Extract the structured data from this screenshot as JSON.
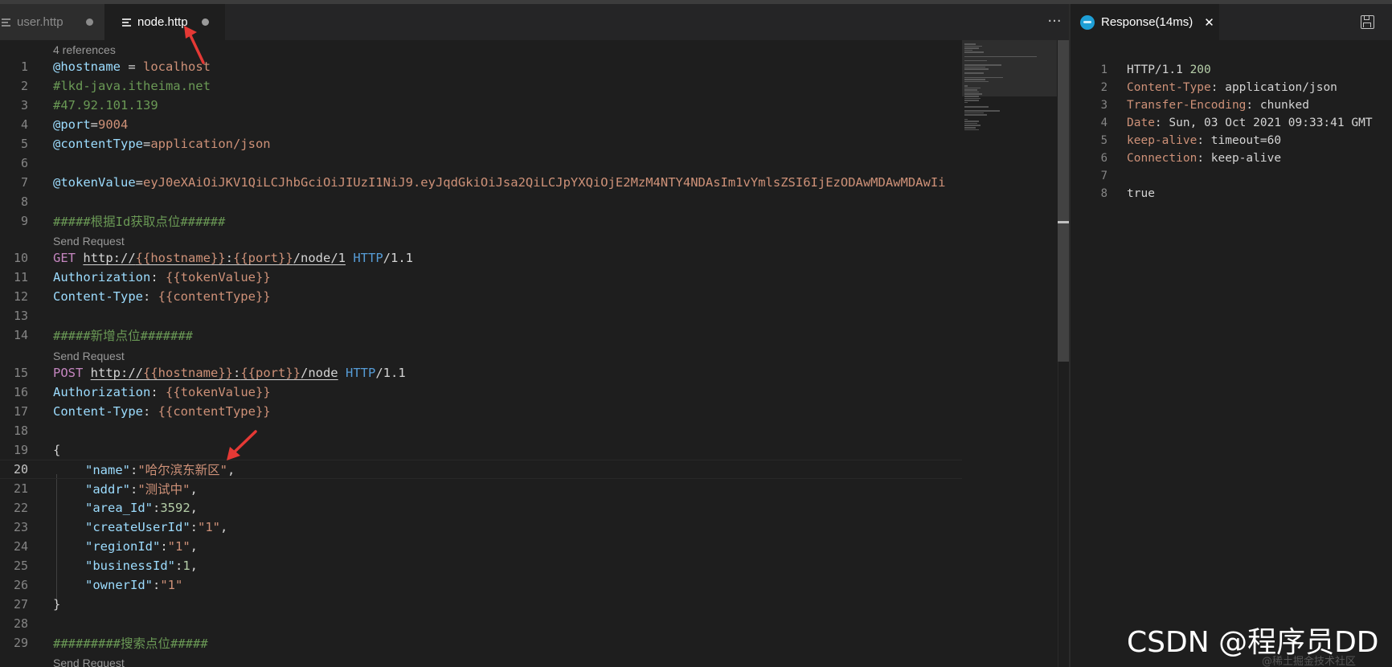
{
  "tabs": {
    "user": "user.http",
    "node": "node.http",
    "more": "···"
  },
  "response_tab": {
    "label": "Response(14ms)",
    "close": "✕"
  },
  "codelens": {
    "references": "4 references",
    "send_request": "Send Request"
  },
  "editor": {
    "line_numbers": [
      "1",
      "2",
      "3",
      "4",
      "5",
      "6",
      "7",
      "8",
      "9",
      "10",
      "11",
      "12",
      "13",
      "14",
      "15",
      "16",
      "17",
      "18",
      "19",
      "20",
      "21",
      "22",
      "23",
      "24",
      "25",
      "26",
      "27",
      "28",
      "29"
    ],
    "l1": {
      "var": "@hostname",
      "op": " = ",
      "val": "localhost"
    },
    "l2": "#lkd-java.itheima.net",
    "l3": "#47.92.101.139",
    "l4": {
      "var": "@port",
      "op": "=",
      "val": "9004"
    },
    "l5": {
      "var": "@contentType",
      "op": "=",
      "val": "application/json"
    },
    "l7": {
      "var": "@tokenValue",
      "op": "=",
      "val": "eyJ0eXAiOiJKV1QiLCJhbGciOiJIUzI1NiJ9.eyJqdGkiOiJsa2QiLCJpYXQiOjE2MzM4NTY4NDAsIm1vYmlsZSI6IjEzODAwMDAwMDAwIi"
    },
    "l9": "#####根据Id获取点位######",
    "l10": {
      "method": "GET",
      "url_a": "http://",
      "url_var1": "{{hostname}}",
      "url_b": ":",
      "url_var2": "{{port}}",
      "url_c": "/node/1",
      "ver_a": "HTTP",
      "ver_b": "/1.1"
    },
    "l11": {
      "key": "Authorization",
      "sep": ": ",
      "val": "{{tokenValue}}"
    },
    "l12": {
      "key": "Content-Type",
      "sep": ": ",
      "val": "{{contentType}}"
    },
    "l14": "#####新增点位#######",
    "l15": {
      "method": "POST",
      "url_a": "http://",
      "url_var1": "{{hostname}}",
      "url_b": ":",
      "url_var2": "{{port}}",
      "url_c": "/node",
      "ver_a": "HTTP",
      "ver_b": "/1.1"
    },
    "l16": {
      "key": "Authorization",
      "sep": ": ",
      "val": "{{tokenValue}}"
    },
    "l17": {
      "key": "Content-Type",
      "sep": ": ",
      "val": "{{contentType}}"
    },
    "l19": "{",
    "l20": {
      "key": "\"name\"",
      "sep": ":",
      "val": "\"哈尔滨东新区\"",
      "end": ","
    },
    "l21": {
      "key": "\"addr\"",
      "sep": ":",
      "val": "\"测试中\"",
      "end": ","
    },
    "l22": {
      "key": "\"area_Id\"",
      "sep": ":",
      "val": "3592",
      "end": ","
    },
    "l23": {
      "key": "\"createUserId\"",
      "sep": ":",
      "val": "\"1\"",
      "end": ","
    },
    "l24": {
      "key": "\"regionId\"",
      "sep": ":",
      "val": "\"1\"",
      "end": ","
    },
    "l25": {
      "key": "\"businessId\"",
      "sep": ":",
      "val": "1",
      "end": ","
    },
    "l26": {
      "key": "\"ownerId\"",
      "sep": ":",
      "val": "\"1\"",
      "end": ""
    },
    "l27": "}",
    "l29": "#########搜索点位#####"
  },
  "response": {
    "line_numbers": [
      "1",
      "2",
      "3",
      "4",
      "5",
      "6",
      "7",
      "8"
    ],
    "r1": {
      "a": "HTTP/1.1 ",
      "b": "200"
    },
    "r2": {
      "k": "Content-Type",
      "v": ": application/json"
    },
    "r3": {
      "k": "Transfer-Encoding",
      "v": ": chunked"
    },
    "r4": {
      "k": "Date",
      "v": ": Sun, 03 Oct 2021 09:33:41 GMT"
    },
    "r5": {
      "k": "keep-alive",
      "v": ": timeout=60"
    },
    "r6": {
      "k": "Connection",
      "v": ": keep-alive"
    },
    "r8": "true"
  },
  "watermark": "CSDN @程序员DD",
  "watermark_faint": "@稀土掘金技术社区",
  "colors": {
    "background": "#1e1e1e",
    "tab_bar": "#252526",
    "variable": "#9cdcfe",
    "string": "#ce9178",
    "comment": "#6a9955",
    "method": "#c586c0",
    "version": "#569cd6",
    "number": "#b5cea8",
    "annotation_arrow": "#e53935"
  }
}
